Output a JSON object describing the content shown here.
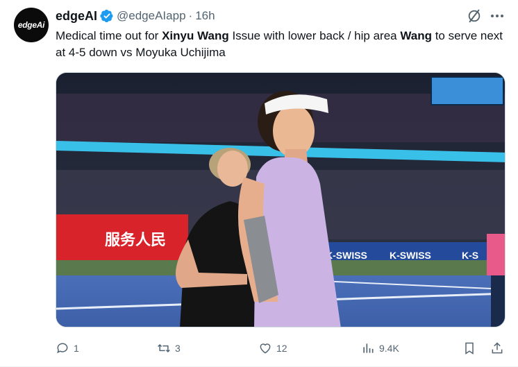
{
  "author": {
    "avatar_text": "edgeAi",
    "display_name": "edgeAI",
    "handle": "@edgeAIapp",
    "separator": "·",
    "time": "16h",
    "verified": true
  },
  "tweet": {
    "text_parts": [
      {
        "text": "Medical time out for ",
        "bold": false
      },
      {
        "text": "Xinyu Wang",
        "bold": true
      },
      {
        "text": " Issue with lower back / hip area ",
        "bold": false
      },
      {
        "text": "Wang",
        "bold": true
      },
      {
        "text": " to serve next at 4-5 down vs Moyuka Uchijima",
        "bold": false
      }
    ]
  },
  "media": {
    "banner_chinese": "服务人民",
    "sponsor_1": "K-SWISS",
    "sponsor_2": "K-SWISS",
    "sponsor_3": "K-S"
  },
  "actions": {
    "replies": "1",
    "reposts": "3",
    "likes": "12",
    "views": "9.4K"
  },
  "icons": {
    "verified": "verified-badge-icon",
    "grok": "grok-icon",
    "more": "more-icon",
    "reply": "reply-icon",
    "repost": "repost-icon",
    "like": "like-icon",
    "views": "views-icon",
    "bookmark": "bookmark-icon",
    "share": "share-icon"
  },
  "colors": {
    "accent": "#1d9bf0",
    "text_primary": "#0f1419",
    "text_secondary": "#536471"
  }
}
